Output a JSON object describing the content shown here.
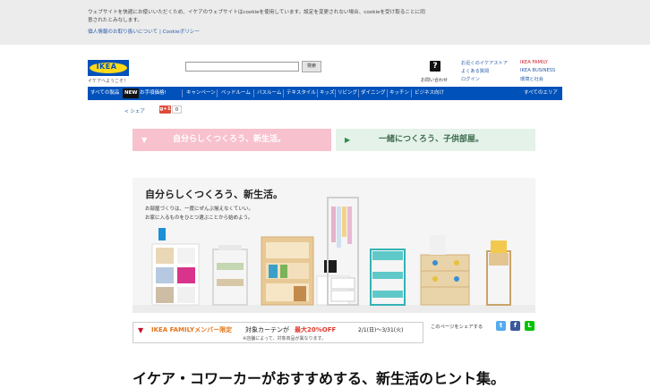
{
  "cookie_bar": {
    "text": "ウェブサイトを快適にお使いいただくため、イケアのウェブサイトはcookieを使用しています。設定を変更されない場合、cookieを受け取ることに同意されたとみなします。",
    "link_privacy": "個人情報のお取り扱いについて",
    "link_separator": "|",
    "link_cookie": "Cookieポリシー"
  },
  "header": {
    "logo": "IKEA",
    "welcome": "イケアへようこそ！",
    "search_button": "検索",
    "help_icon": "?",
    "help_label": "お問い合わせ",
    "links_col1": [
      "お近くのイケアストア",
      "よくある質問",
      "ログイン"
    ],
    "links_col2": [
      "IKEA FAMILY",
      "IKEA BUSINESS",
      "環境と社会"
    ]
  },
  "nav": {
    "items": [
      "すべての製品",
      "NEW",
      "お手頃価格!",
      "キャンペーン",
      "ベッドルーム",
      "バスルーム",
      "テキスタイル",
      "キッズ",
      "リビング",
      "ダイニング",
      "キッチン",
      "ビジネス向け",
      "すべてのエリア"
    ]
  },
  "share": {
    "label": "シェア",
    "gplus": "g+1",
    "count": "0"
  },
  "banners": {
    "left": "自分らしくつくろう、新生活。",
    "right": "一緒につくろう、子供部屋。"
  },
  "hero": {
    "title": "自分らしくつくろう、新生活。",
    "line1": "お部屋づくりは、一度にぜんぶ揃えなくていい。",
    "line2": "お家に入るものをひとつ選ぶことから始めよう。"
  },
  "promo": {
    "family_label": "IKEA FAMILYメンバー限定",
    "text": "対象カーテンが",
    "discount": "最大20%OFF",
    "dates": "2/1(日)〜3/31(火)",
    "note": "※店舗によって、対象商品が異なります。"
  },
  "share_page": {
    "label": "このページをシェアする",
    "icons": [
      "twitter-icon",
      "facebook-icon",
      "line-icon"
    ],
    "colors": [
      "#55acee",
      "#3b5998",
      "#00c300"
    ]
  },
  "bottom": {
    "heading": "イケア・コワーカーがおすすめする、新生活のヒント集。"
  },
  "colors": {
    "brand_blue": "#0051ba",
    "brand_yellow": "#ffda1a",
    "pink_banner": "#f8c1ce",
    "green_banner": "#e4f2e9"
  }
}
